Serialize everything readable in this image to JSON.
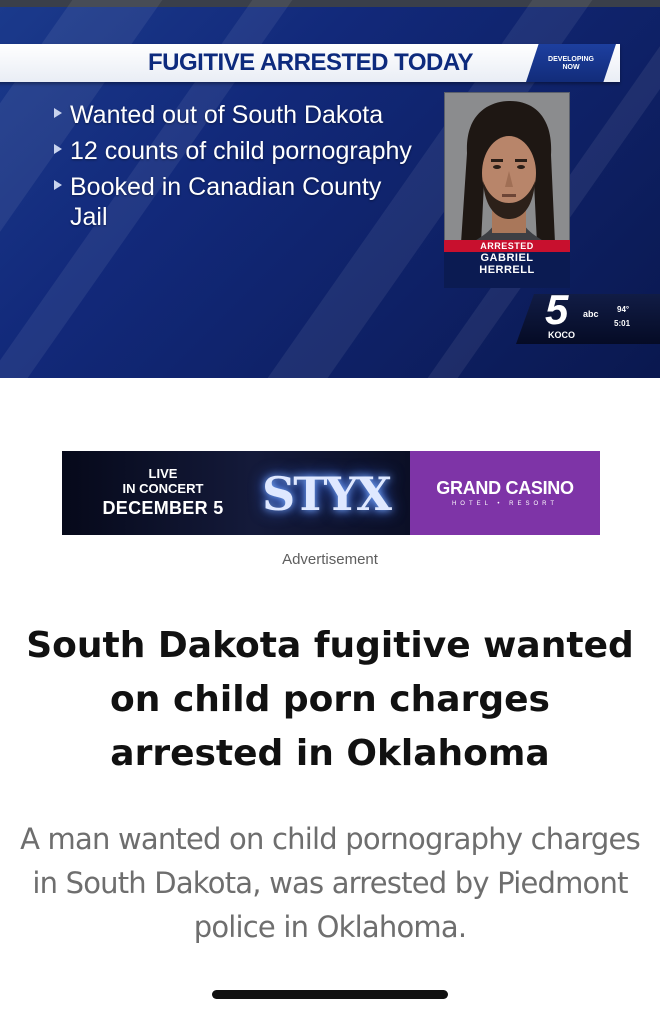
{
  "video": {
    "headline": "FUGITIVE ARRESTED TODAY",
    "badge_line1": "DEVELOPING",
    "badge_line2": "NOW",
    "bullets": [
      {
        "text": "Wanted out of South Dakota"
      },
      {
        "text": "12 counts of child pornography"
      },
      {
        "text": "Booked in Canadian County Jail"
      }
    ],
    "mugshot": {
      "label": "ARRESTED",
      "name_line1": "GABRIEL",
      "name_line2": "HERRELL"
    },
    "station": {
      "number": "5",
      "network": "abc",
      "call_sign": "KOCO",
      "temperature": "94°",
      "time": "5:01"
    }
  },
  "ad": {
    "live": "LIVE",
    "in_concert": "IN CONCERT",
    "date": "DECEMBER 5",
    "band": "STYX",
    "venue": "GRAND CASINO",
    "venue_sub": "HOTEL • RESORT",
    "caption": "Advertisement",
    "colors": {
      "venue_bg": "#7e34a7",
      "band_glow": "#7fb0ff"
    }
  },
  "article": {
    "title": "South Dakota fugitive wanted on child porn charges arrested in Oklahoma",
    "summary": "A man wanted on child pornography charges in South Dakota, was arrested by Piedmont police in Oklahoma."
  },
  "colors": {
    "video_bg": "#12297a",
    "headline_text": "#0d2a7d",
    "arrested_red": "#c8102e"
  }
}
